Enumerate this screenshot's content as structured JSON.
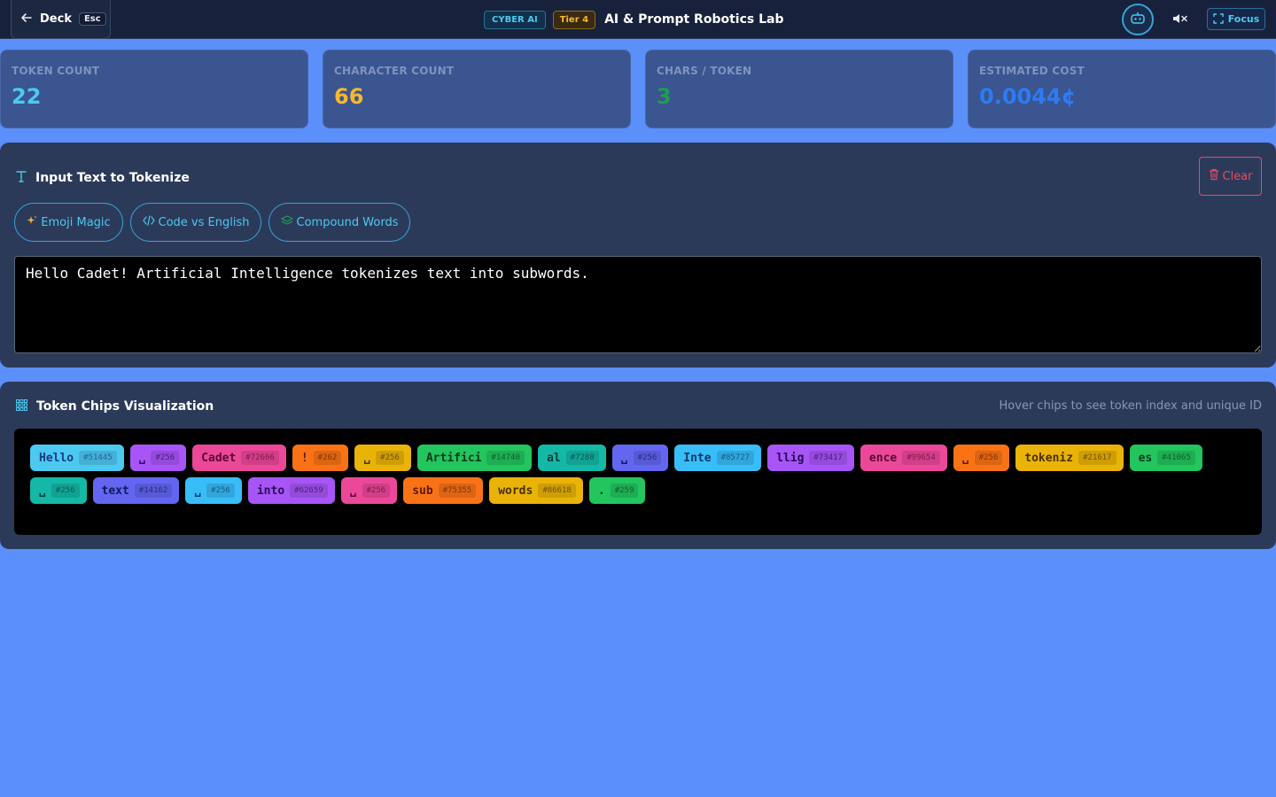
{
  "topbar": {
    "back_label": "Deck",
    "back_key": "Esc",
    "badge_cyber": "CYBER AI",
    "badge_tier": "Tier 4",
    "title": "AI & Prompt Robotics Lab",
    "focus_label": "Focus"
  },
  "stats": [
    {
      "label": "TOKEN COUNT",
      "value": "22",
      "color": "#4cc9f0"
    },
    {
      "label": "CHARACTER COUNT",
      "value": "66",
      "color": "#f7b731"
    },
    {
      "label": "CHARS / TOKEN",
      "value": "3",
      "color": "#1f9d55"
    },
    {
      "label": "ESTIMATED COST",
      "value": "0.0044¢",
      "color": "#2d7bf4"
    }
  ],
  "input_panel": {
    "title": "Input Text to Tokenize",
    "clear_label": "Clear",
    "presets": [
      "Emoji Magic",
      "Code vs English",
      "Compound Words"
    ],
    "text_value": "Hello Cadet! Artificial Intelligence tokenizes text into subwords."
  },
  "chips_panel": {
    "title": "Token Chips Visualization",
    "hint": "Hover chips to see token index and unique ID",
    "chips": [
      {
        "text": "Hello",
        "id": "#51445",
        "bg": "#4cc9f0",
        "fg": "#1a3a8a"
      },
      {
        "text": "␣",
        "id": "#256",
        "bg": "#a855f7",
        "fg": "#2a0a5a"
      },
      {
        "text": "Cadet",
        "id": "#72606",
        "bg": "#ec4899",
        "fg": "#5a0a30"
      },
      {
        "text": "!",
        "id": "#262",
        "bg": "#f97316",
        "fg": "#5a1a00"
      },
      {
        "text": "␣",
        "id": "#256",
        "bg": "#eab308",
        "fg": "#4a3000"
      },
      {
        "text": "Artifici",
        "id": "#14740",
        "bg": "#22c55e",
        "fg": "#0a3a1a"
      },
      {
        "text": "al",
        "id": "#7280",
        "bg": "#14b8a6",
        "fg": "#053a34"
      },
      {
        "text": "␣",
        "id": "#256",
        "bg": "#6366f1",
        "fg": "#101a5a"
      },
      {
        "text": "Inte",
        "id": "#85727",
        "bg": "#38bdf8",
        "fg": "#0a3a6a"
      },
      {
        "text": "llig",
        "id": "#73417",
        "bg": "#a855f7",
        "fg": "#2a0a5a"
      },
      {
        "text": "ence",
        "id": "#99654",
        "bg": "#ec4899",
        "fg": "#5a0a30"
      },
      {
        "text": "␣",
        "id": "#256",
        "bg": "#f97316",
        "fg": "#5a1a00"
      },
      {
        "text": "tokeniz",
        "id": "#21617",
        "bg": "#eab308",
        "fg": "#4a3000"
      },
      {
        "text": "es",
        "id": "#41065",
        "bg": "#22c55e",
        "fg": "#0a3a1a"
      },
      {
        "text": "␣",
        "id": "#256",
        "bg": "#14b8a6",
        "fg": "#053a34"
      },
      {
        "text": "text",
        "id": "#14162",
        "bg": "#6366f1",
        "fg": "#101a5a"
      },
      {
        "text": "␣",
        "id": "#256",
        "bg": "#38bdf8",
        "fg": "#0a3a6a"
      },
      {
        "text": "into",
        "id": "#62659",
        "bg": "#a855f7",
        "fg": "#2a0a5a"
      },
      {
        "text": "␣",
        "id": "#256",
        "bg": "#ec4899",
        "fg": "#5a0a30"
      },
      {
        "text": "sub",
        "id": "#75355",
        "bg": "#f97316",
        "fg": "#5a1a00"
      },
      {
        "text": "words",
        "id": "#86618",
        "bg": "#eab308",
        "fg": "#4a3000"
      },
      {
        "text": ".",
        "id": "#259",
        "bg": "#22c55e",
        "fg": "#0a3a1a"
      }
    ]
  }
}
